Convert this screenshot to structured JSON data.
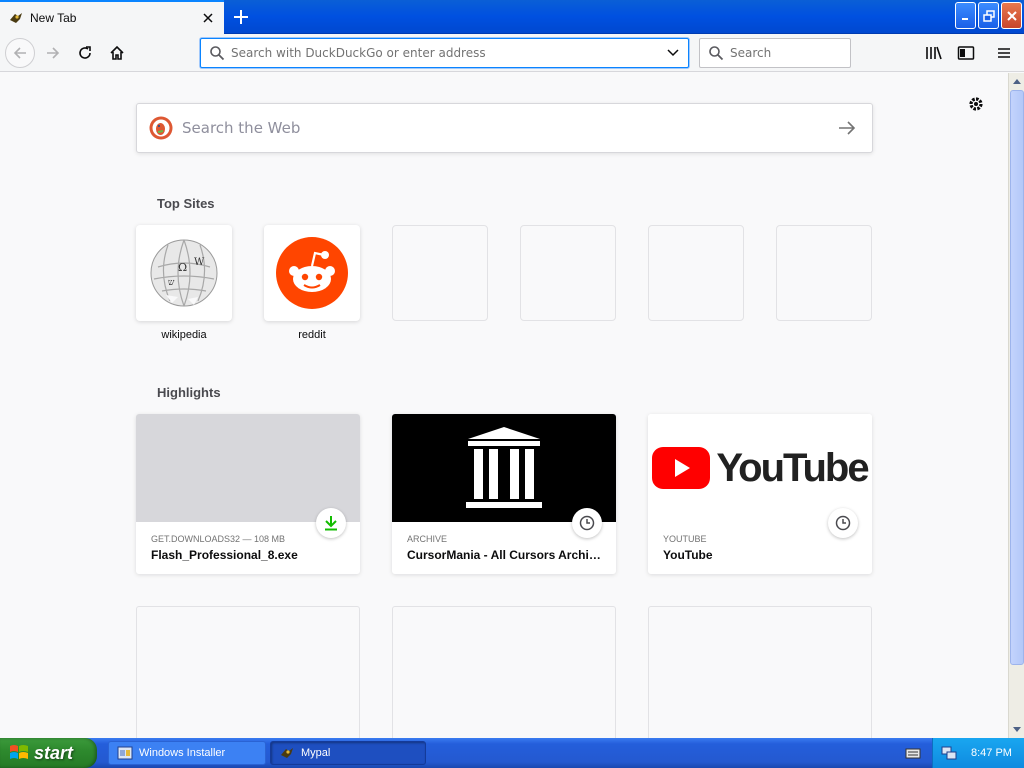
{
  "browser": {
    "tab": {
      "title": "New Tab"
    },
    "urlbar": {
      "placeholder": "Search with DuckDuckGo or enter address"
    },
    "searchbar": {
      "placeholder": "Search"
    }
  },
  "newtab": {
    "web_search": {
      "placeholder": "Search the Web"
    },
    "top_sites": {
      "heading": "Top Sites",
      "sites": [
        {
          "label": "wikipedia",
          "icon": "wikipedia-logo-icon"
        },
        {
          "label": "reddit",
          "icon": "reddit-logo-icon"
        },
        {
          "label": "",
          "icon": ""
        },
        {
          "label": "",
          "icon": ""
        },
        {
          "label": "",
          "icon": ""
        },
        {
          "label": "",
          "icon": ""
        }
      ]
    },
    "highlights": {
      "heading": "Highlights",
      "cards": [
        {
          "meta": "GET.DOWNLOADS32 — 108 MB",
          "title": "Flash_Professional_8.exe",
          "badge": "download-icon"
        },
        {
          "meta": "ARCHIVE",
          "title": "CursorMania - All Cursors Archiv…",
          "badge": "clock-icon"
        },
        {
          "meta": "YOUTUBE",
          "title": "YouTube",
          "badge": "clock-icon",
          "logo_text": "YouTube"
        }
      ]
    }
  },
  "taskbar": {
    "start_label": "start",
    "items": [
      {
        "label": "Windows Installer",
        "state": "inactive"
      },
      {
        "label": "Mypal",
        "state": "active"
      }
    ],
    "clock": "8:47 PM"
  },
  "colors": {
    "accent": "#0a84ff",
    "reddit": "#ff4500",
    "youtube_red": "#ff0000",
    "download_green": "#2ac3a2",
    "xp_start_green": "#2e8a2e",
    "xp_taskbar_blue": "#245edb"
  }
}
